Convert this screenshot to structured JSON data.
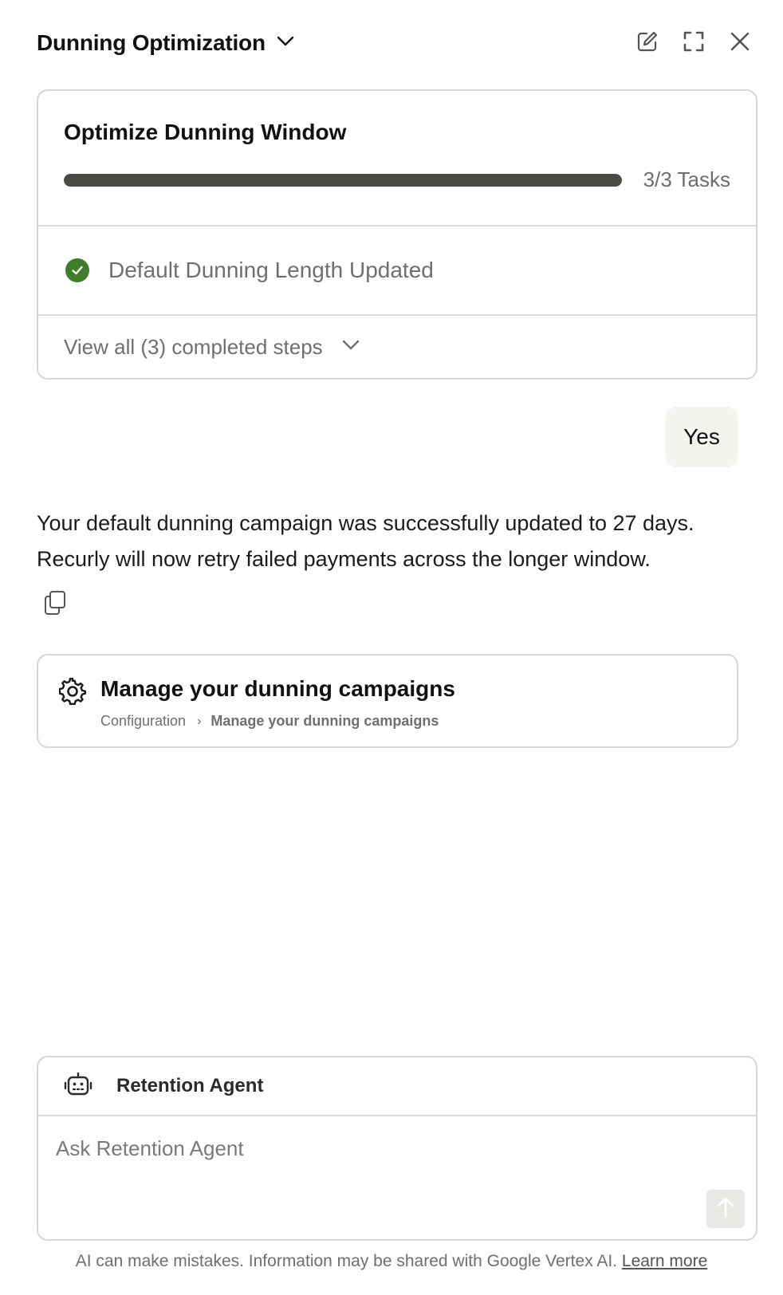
{
  "header": {
    "title": "Dunning Optimization",
    "icons": [
      "chevron-down-icon",
      "edit-icon",
      "expand-icon",
      "close-icon"
    ]
  },
  "task_card": {
    "title": "Optimize Dunning Window",
    "progress_fraction": 1.0,
    "progress_label": "3/3 Tasks",
    "current_step": {
      "label": "Default Dunning Length Updated",
      "status": "completed",
      "icon": "check-circle-icon"
    },
    "view_all_label": "View all (3) completed steps"
  },
  "conversation": {
    "user_message": "Yes",
    "assistant_message": "Your default dunning campaign was successfully updated to 27 days. Recurly will now retry failed payments across the longer window."
  },
  "link_card": {
    "title": "Manage your dunning campaigns",
    "icon": "gear-icon",
    "breadcrumb": {
      "parent": "Configuration",
      "current": "Manage your dunning campaigns"
    }
  },
  "composer": {
    "agent_name": "Retention Agent",
    "agent_icon": "robot-icon",
    "placeholder": "Ask Retention Agent",
    "value": ""
  },
  "footer": {
    "note": "AI can make mistakes. Information may be shared with Google Vertex AI.",
    "link": "Learn more"
  },
  "colors": {
    "success": "#3f7d2b",
    "progress_fill": "#4a4b47",
    "border": "#d6d6d3",
    "muted_text": "#6f706c",
    "bubble_bg": "#f4f4f1"
  }
}
